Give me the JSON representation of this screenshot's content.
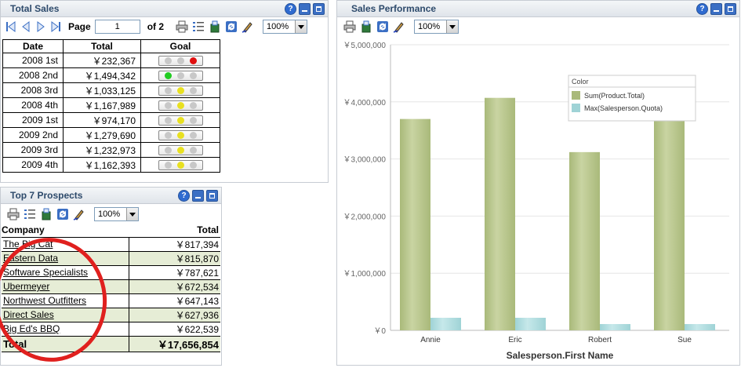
{
  "total_sales": {
    "title": "Total Sales",
    "page_label": "Page",
    "page_value": "1",
    "of_label": "of 2",
    "zoom": "100%",
    "columns": [
      "Date",
      "Total",
      "Goal"
    ],
    "rows": [
      {
        "date": "2008 1st",
        "total": "￥232,367",
        "goal": "red"
      },
      {
        "date": "2008 2nd",
        "total": "￥1,494,342",
        "goal": "green"
      },
      {
        "date": "2008 3rd",
        "total": "￥1,033,125",
        "goal": "yellow"
      },
      {
        "date": "2008 4th",
        "total": "￥1,167,989",
        "goal": "yellow"
      },
      {
        "date": "2009 1st",
        "total": "￥974,170",
        "goal": "yellow"
      },
      {
        "date": "2009 2nd",
        "total": "￥1,279,690",
        "goal": "yellow"
      },
      {
        "date": "2009 3rd",
        "total": "￥1,232,973",
        "goal": "yellow"
      },
      {
        "date": "2009 4th",
        "total": "￥1,162,393",
        "goal": "yellow"
      }
    ]
  },
  "prospects": {
    "title": "Top 7 Prospects",
    "zoom": "100%",
    "columns": [
      "Company",
      "Total"
    ],
    "rows": [
      {
        "company": "The Big Cat",
        "total": "￥817,394"
      },
      {
        "company": "Eastern Data",
        "total": "￥815,870"
      },
      {
        "company": "Software Specialists",
        "total": "￥787,621"
      },
      {
        "company": "Ubermeyer",
        "total": "￥672,534"
      },
      {
        "company": "Northwest Outfitters",
        "total": "￥647,143"
      },
      {
        "company": "Direct Sales",
        "total": "￥627,936"
      },
      {
        "company": "Big Ed's BBQ",
        "total": "￥622,539"
      }
    ],
    "grand_label": "Total",
    "grand_total": "￥17,656,854"
  },
  "performance": {
    "title": "Sales Performance",
    "zoom": "100%"
  },
  "colors": {
    "series1": "#a9b97a",
    "series2": "#9fd3d6",
    "light_red": "#e01010",
    "light_green": "#22cc22",
    "light_yellow": "#e8e020",
    "light_off": "#c8c8c8",
    "highlight": "#e0201e"
  },
  "chart_data": {
    "type": "bar",
    "categories": [
      "Annie",
      "Eric",
      "Robert",
      "Sue"
    ],
    "series": [
      {
        "name": "Sum(Product.Total)",
        "values": [
          3700000,
          4070000,
          3120000,
          3960000
        ]
      },
      {
        "name": "Max(Salesperson.Quota)",
        "values": [
          220000,
          220000,
          110000,
          110000
        ]
      }
    ],
    "ylim": [
      0,
      5000000
    ],
    "yticks": [
      "￥0",
      "￥1,000,000",
      "￥2,000,000",
      "￥3,000,000",
      "￥4,000,000",
      "￥5,000,000"
    ],
    "yticks_values": [
      0,
      1000000,
      2000000,
      3000000,
      4000000,
      5000000
    ],
    "xlabel": "Salesperson.First Name",
    "legend_title": "Color",
    "legend_position": "top-right",
    "grid": true
  }
}
